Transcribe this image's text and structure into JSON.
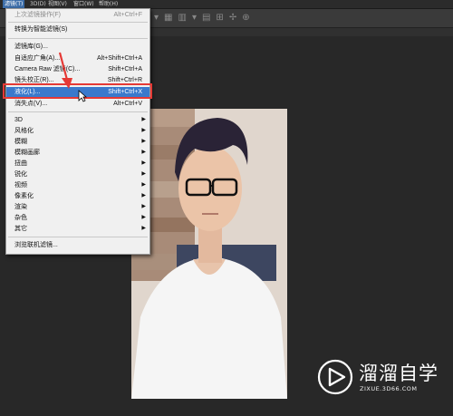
{
  "menubar": {
    "items": [
      {
        "label": "滤镜(T)",
        "active": true
      },
      {
        "label": "3D(D)",
        "active": false
      },
      {
        "label": "视图(V)",
        "active": false
      },
      {
        "label": "窗口(W)",
        "active": false
      },
      {
        "label": "帮助(H)",
        "active": false
      }
    ]
  },
  "filter_menu": {
    "items": [
      {
        "label": "上次滤镜操作(F)",
        "shortcut": "Alt+Ctrl+F",
        "disabled": true
      },
      {
        "label": "转换为智能滤镜(S)",
        "shortcut": ""
      },
      {
        "label": "滤镜库(G)...",
        "shortcut": ""
      },
      {
        "label": "自适应广角(A)...",
        "shortcut": "Alt+Shift+Ctrl+A"
      },
      {
        "label": "Camera Raw 滤镜(C)...",
        "shortcut": "Shift+Ctrl+A"
      },
      {
        "label": "镜头校正(R)...",
        "shortcut": "Shift+Ctrl+R"
      },
      {
        "label": "液化(L)...",
        "shortcut": "Shift+Ctrl+X",
        "highlighted": true
      },
      {
        "label": "消失点(V)...",
        "shortcut": "Alt+Ctrl+V"
      },
      {
        "label": "3D",
        "submenu": true
      },
      {
        "label": "风格化",
        "submenu": true
      },
      {
        "label": "模糊",
        "submenu": true
      },
      {
        "label": "模糊画廊",
        "submenu": true
      },
      {
        "label": "扭曲",
        "submenu": true
      },
      {
        "label": "锐化",
        "submenu": true
      },
      {
        "label": "视频",
        "submenu": true
      },
      {
        "label": "像素化",
        "submenu": true
      },
      {
        "label": "渲染",
        "submenu": true
      },
      {
        "label": "杂色",
        "submenu": true
      },
      {
        "label": "其它",
        "submenu": true
      },
      {
        "label": "浏览联机滤镜..."
      }
    ],
    "submenu_glyph": "▶"
  },
  "watermark": {
    "title": "溜溜自学",
    "subtitle": "ZIXUE.3D66.COM"
  },
  "colors": {
    "menu_bg": "#f0f0f0",
    "highlight": "#3a79cc",
    "annotation": "#e53935",
    "workspace": "#282828"
  },
  "icons": [
    "dropdown-icon",
    "align-icon",
    "distribute-icon",
    "move-3d-icon",
    "annotation-arrow-icon",
    "play-logo-icon"
  ]
}
